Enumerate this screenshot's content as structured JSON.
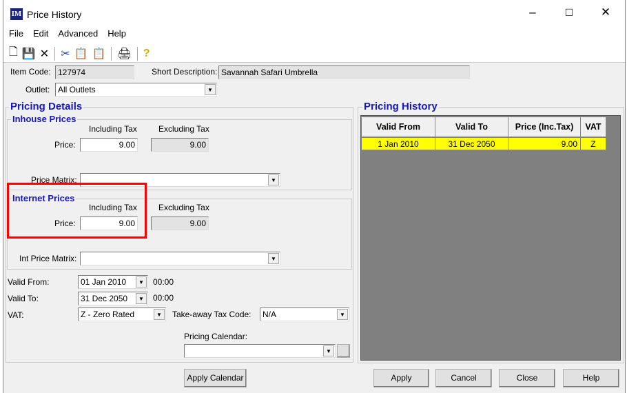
{
  "window": {
    "title": "Price History",
    "logo": "IM",
    "controls": [
      "minimize",
      "maximize",
      "close"
    ]
  },
  "menu": [
    "File",
    "Edit",
    "Advanced",
    "Help"
  ],
  "toolbar": [
    "new-icon",
    "save-icon",
    "delete-icon",
    "cut-icon",
    "copy-icon",
    "paste-icon",
    "print-icon",
    "help-icon"
  ],
  "item": {
    "code_label": "Item Code:",
    "code": "127974",
    "desc_label": "Short Description:",
    "desc": "Savannah Safari Umbrella",
    "outlet_label": "Outlet:",
    "outlet": "All Outlets"
  },
  "pricing": {
    "title": "Pricing Details",
    "inhouse": {
      "title": "Inhouse Prices",
      "incl_label": "Including Tax",
      "excl_label": "Excluding Tax",
      "price_label": "Price:",
      "incl": "9.00",
      "excl": "9.00",
      "matrix_label": "Price Matrix:",
      "matrix": ""
    },
    "internet": {
      "title": "Internet Prices",
      "incl_label": "Including Tax",
      "excl_label": "Excluding Tax",
      "price_label": "Price:",
      "incl": "9.00",
      "excl": "9.00",
      "matrix_label": "Int Price Matrix:",
      "matrix": ""
    },
    "valid_from_label": "Valid From:",
    "valid_from": "01 Jan 2010",
    "valid_from_time": "00:00",
    "valid_to_label": "Valid To:",
    "valid_to": "31 Dec 2050",
    "valid_to_time": "00:00",
    "vat_label": "VAT:",
    "vat": "Z - Zero Rated",
    "takeaway_label": "Take-away Tax Code:",
    "takeaway": "N/A",
    "calendar_label": "Pricing Calendar:",
    "calendar": ""
  },
  "history": {
    "title": "Pricing History",
    "columns": [
      "Valid From",
      "Valid To",
      "Price (Inc.Tax)",
      "VAT"
    ],
    "rows": [
      [
        "1 Jan 2010",
        "31 Dec 2050",
        "9.00",
        "Z"
      ]
    ]
  },
  "buttons": {
    "apply_calendar": "Apply Calendar",
    "apply": "Apply",
    "cancel": "Cancel",
    "close": "Close",
    "help": "Help"
  },
  "colors": {
    "highlight_row": "#ffff00",
    "group_title": "#1616c8",
    "annotation_box": "#ff0000"
  }
}
